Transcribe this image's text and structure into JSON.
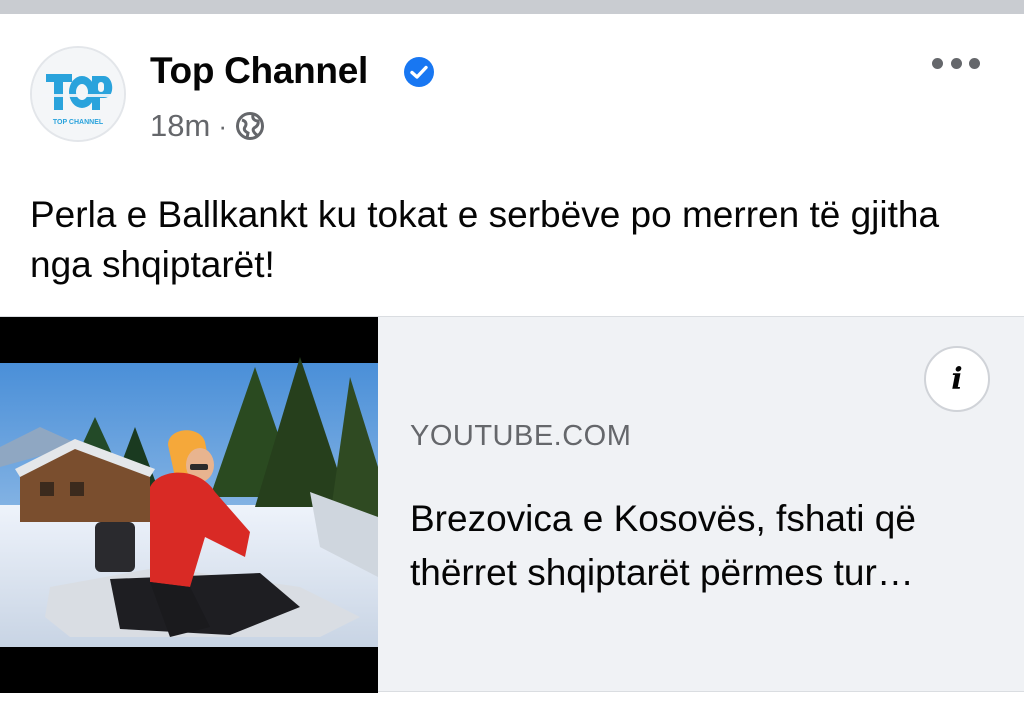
{
  "post": {
    "author": "Top Channel",
    "avatar_logo_text": "TOP CHANNEL",
    "timestamp": "18m",
    "separator": "·",
    "privacy_icon": "globe-icon",
    "verified_icon": "verified-badge-icon",
    "more_icon": "more-options-icon",
    "text": "Perla e Ballkankt ku tokat e serbëve po merren të gjitha nga shqiptarët!"
  },
  "link_preview": {
    "domain": "YOUTUBE.COM",
    "title": "Brezovica e Kosovës, fshati që thërret shqiptarët përmes tur…",
    "info_label": "i",
    "thumbnail_description_icon": "video-thumbnail"
  },
  "colors": {
    "verified": "#1877f2",
    "secondary_text": "#65676b",
    "card_bg": "#f0f2f5",
    "logo_blue": "#2aa3dc"
  }
}
